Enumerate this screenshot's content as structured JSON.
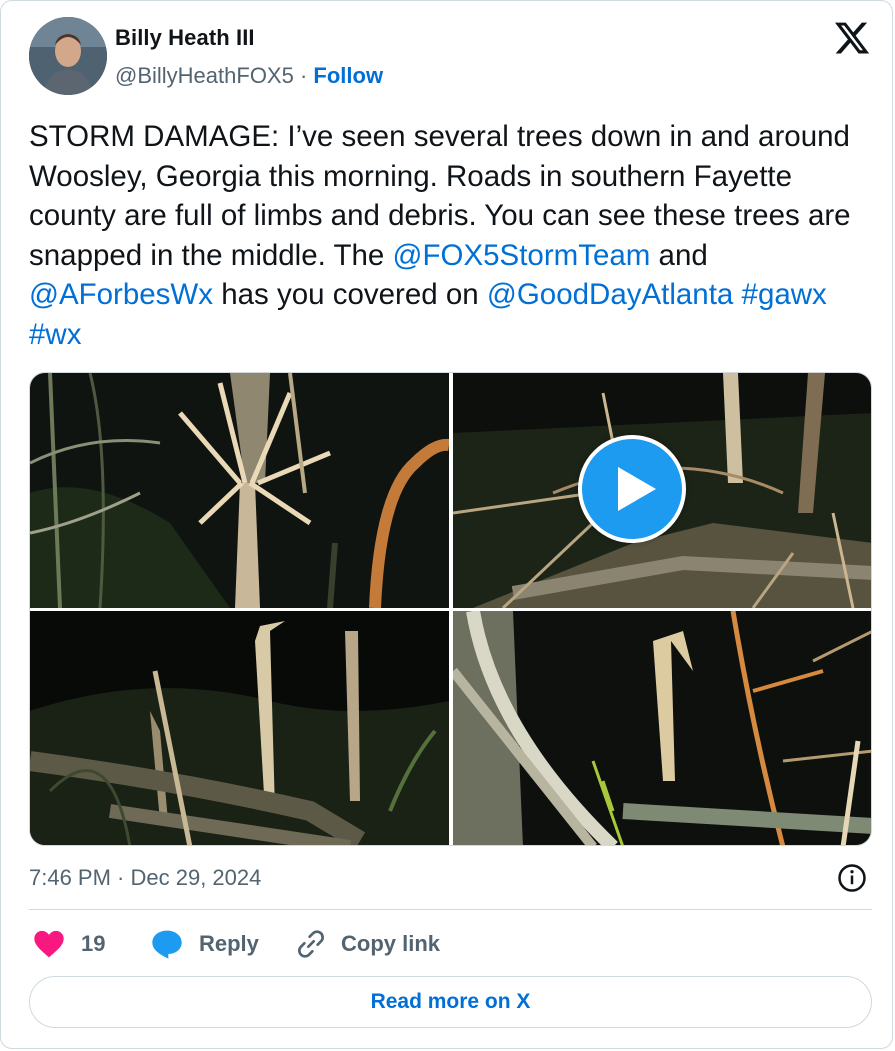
{
  "author": {
    "name": "Billy Heath III",
    "handle": "@BillyHeathFOX5",
    "separator": "·",
    "follow_label": "Follow"
  },
  "tweet": {
    "text_before": "STORM DAMAGE: I’ve seen several trees down in and around Woosley, Georgia this morning. Roads in southern Fayette county are full of limbs and debris. You can see these trees are snapped in the middle. The ",
    "mention1": "@FOX5StormTeam",
    "and_text": " and ",
    "mention2": "@AForbesWx",
    "text_middle": " has you covered on ",
    "mention3": "@GoodDayAtlanta",
    "space": " ",
    "hashtag1": "#gawx",
    "hashtag2": "#wx"
  },
  "timestamp": "7:46 PM · Dec 29, 2024",
  "actions": {
    "like_count": "19",
    "reply_label": "Reply",
    "copy_label": "Copy link"
  },
  "read_more_label": "Read more on X",
  "icons": {
    "logo": "x-logo-icon",
    "info": "info-icon",
    "like": "heart-icon",
    "reply": "reply-bubble-icon",
    "copy": "link-icon",
    "play": "play-icon"
  },
  "colors": {
    "link": "#006fd6",
    "secondary_text": "#536471",
    "heart": "#f91880",
    "play_button": "#1d9bf0",
    "border": "#cfd9de"
  }
}
